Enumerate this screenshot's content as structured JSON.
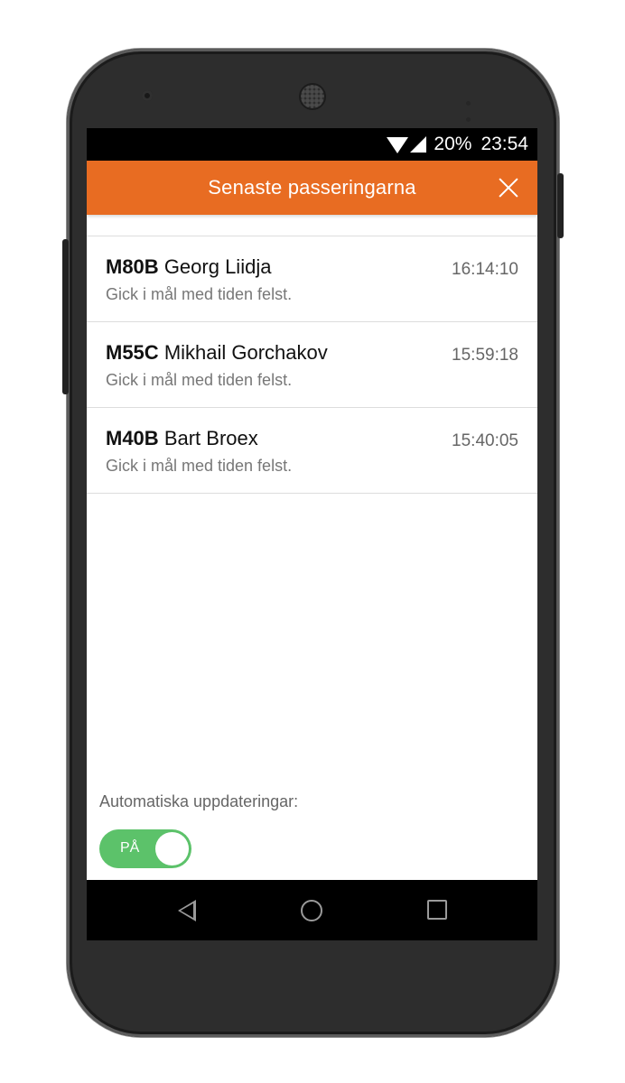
{
  "status_bar": {
    "battery": "20%",
    "time": "23:54",
    "icons": [
      "wifi-icon",
      "signal-icon"
    ]
  },
  "app_bar": {
    "title": "Senaste passeringarna",
    "close_icon": "close-icon",
    "color": "#e86c22"
  },
  "passings": [
    {
      "code": "M80B",
      "name": "Georg Liidja",
      "status": "Gick i mål med tiden felst.",
      "time": "16:14:10"
    },
    {
      "code": "M55C",
      "name": "Mikhail Gorchakov",
      "status": "Gick i mål med tiden felst.",
      "time": "15:59:18"
    },
    {
      "code": "M40B",
      "name": "Bart Broex",
      "status": "Gick i mål med tiden felst.",
      "time": "15:40:05"
    }
  ],
  "auto_updates": {
    "label": "Automatiska uppdateringar:",
    "toggle_text": "PÅ",
    "enabled": true,
    "color": "#5cc26a"
  },
  "nav_bar": {
    "icons": [
      "back-icon",
      "home-icon",
      "recent-apps-icon"
    ]
  }
}
